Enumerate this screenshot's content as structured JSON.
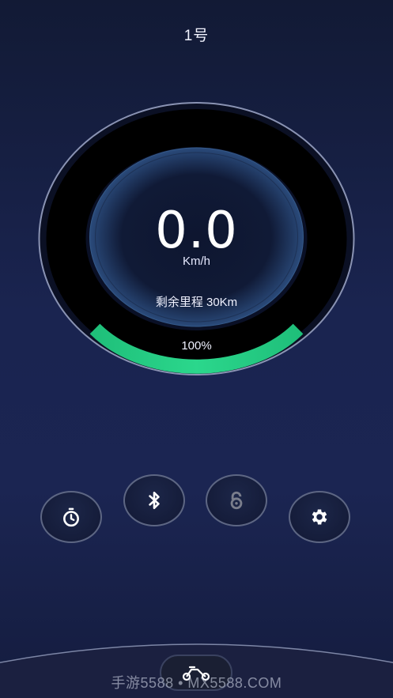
{
  "header": {
    "title": "1号"
  },
  "dashboard": {
    "speed": "0.0",
    "speed_unit": "Km/h",
    "remaining_range": "剩余里程 30Km",
    "battery_percent": "100%",
    "battery_level": 1.0
  },
  "controls": {
    "buttons": [
      {
        "icon": "stopwatch-icon"
      },
      {
        "icon": "bluetooth-icon"
      },
      {
        "icon": "lock-icon"
      },
      {
        "icon": "gear-icon"
      }
    ]
  },
  "bottom": {
    "mode_icon": "scooter-icon"
  },
  "watermark": "手游5588 • MX5588.COM",
  "colors": {
    "accent_green": "#1fbf7a",
    "background": "#1a2450"
  }
}
